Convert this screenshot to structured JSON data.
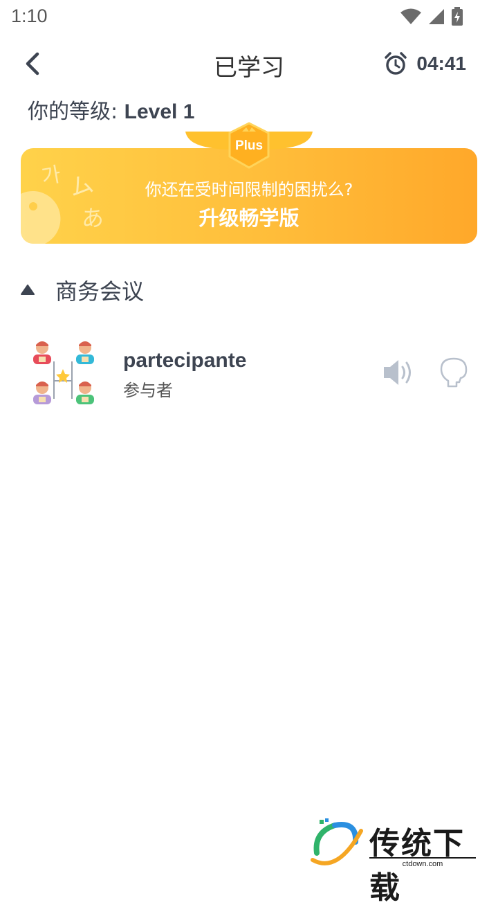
{
  "status_bar": {
    "time": "1:10"
  },
  "header": {
    "title": "已学习",
    "timer": "04:41"
  },
  "level": {
    "label": "你的等级: ",
    "value": "Level 1"
  },
  "banner": {
    "badge": "Plus",
    "subtitle": "你还在受时间限制的困扰么?",
    "title": "升级畅学版"
  },
  "section": {
    "title": "商务会议"
  },
  "word": {
    "term": "partecipante",
    "translation": "参与者"
  },
  "watermark": {
    "text": "传统下载",
    "url": "ctdown.com"
  },
  "colors": {
    "banner_start": "#ffd24a",
    "banner_end": "#ffa82a",
    "text_primary": "#3d4451",
    "icon_grey": "#b8c0cc"
  },
  "icons": [
    "back-icon",
    "alarm-clock-icon",
    "wifi-icon",
    "signal-icon",
    "battery-icon",
    "triangle-up-icon",
    "speaker-icon",
    "speak-head-icon"
  ]
}
